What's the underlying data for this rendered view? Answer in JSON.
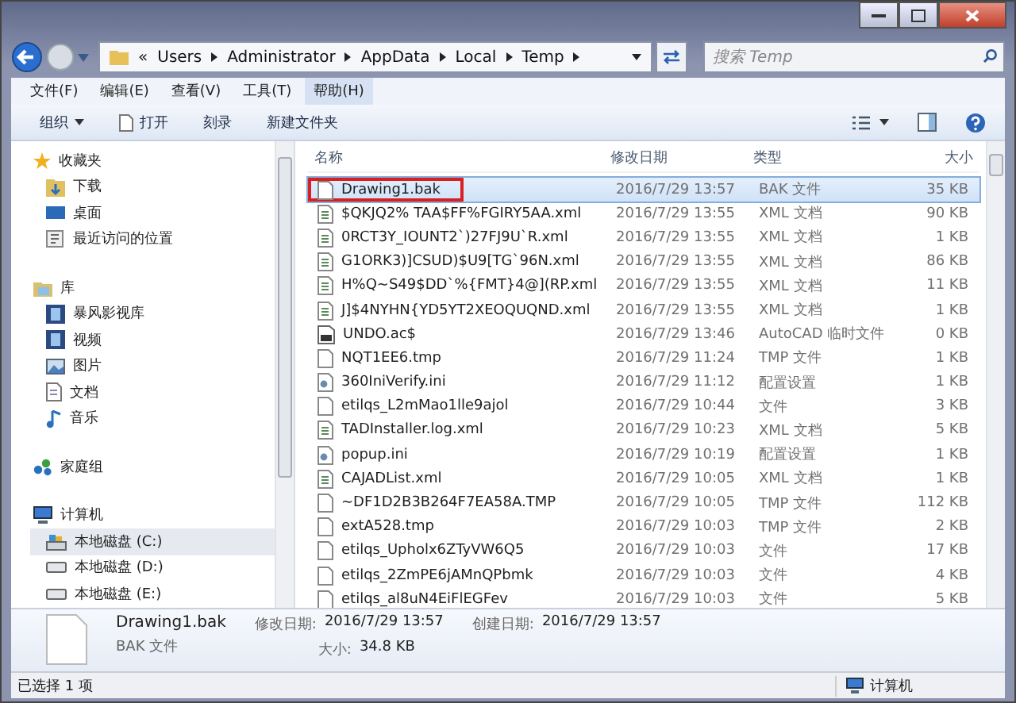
{
  "address": {
    "prefix": "«",
    "crumbs": [
      "Users",
      "Administrator",
      "AppData",
      "Local",
      "Temp"
    ]
  },
  "search": {
    "placeholder": "搜索 Temp"
  },
  "menu": [
    {
      "label": "文件(F)",
      "selected": false
    },
    {
      "label": "编辑(E)",
      "selected": false
    },
    {
      "label": "查看(V)",
      "selected": false
    },
    {
      "label": "工具(T)",
      "selected": false
    },
    {
      "label": "帮助(H)",
      "selected": true
    }
  ],
  "toolbar": [
    {
      "label": "组织",
      "kind": "dropdown"
    },
    {
      "label": "打开",
      "kind": "open"
    },
    {
      "label": "刻录",
      "kind": "plain"
    },
    {
      "label": "新建文件夹",
      "kind": "plain"
    }
  ],
  "sidebar": [
    {
      "label": "收藏夹",
      "kind": "star",
      "selected": false,
      "children": [
        {
          "label": "下载",
          "kind": "download",
          "selected": false
        },
        {
          "label": "桌面",
          "kind": "desktop",
          "selected": false
        },
        {
          "label": "最近访问的位置",
          "kind": "recent",
          "selected": false
        }
      ]
    },
    {
      "label": "库",
      "kind": "library",
      "selected": false,
      "children": [
        {
          "label": "暴风影视库",
          "kind": "video",
          "selected": false
        },
        {
          "label": "视频",
          "kind": "video",
          "selected": false
        },
        {
          "label": "图片",
          "kind": "picture",
          "selected": false
        },
        {
          "label": "文档",
          "kind": "document",
          "selected": false
        },
        {
          "label": "音乐",
          "kind": "music",
          "selected": false
        }
      ]
    },
    {
      "label": "家庭组",
      "kind": "homegroup",
      "selected": false
    },
    {
      "label": "计算机",
      "kind": "computer",
      "selected": false,
      "children": [
        {
          "label": "本地磁盘 (C:)",
          "kind": "system",
          "selected": true
        },
        {
          "label": "本地磁盘 (D:)",
          "kind": "drive",
          "selected": false
        },
        {
          "label": "本地磁盘 (E:)",
          "kind": "drive",
          "selected": false
        }
      ]
    }
  ],
  "table": {
    "columns": [
      "名称",
      "修改日期",
      "类型",
      "大小"
    ],
    "rows": [
      {
        "name": "Drawing1.bak",
        "date": "2016/7/29 13:57",
        "type": "BAK 文件",
        "size": "35 KB",
        "kind": "file",
        "selected": true,
        "highlighted": true
      },
      {
        "name": "$QKJQ2% TAA$FF%FGIRY5AA.xml",
        "date": "2016/7/29 13:55",
        "type": "XML 文档",
        "size": "90 KB",
        "kind": "xml",
        "selected": false,
        "highlighted": false
      },
      {
        "name": "0RCT3Y_IOUNT2`)27FJ9U`R.xml",
        "date": "2016/7/29 13:55",
        "type": "XML 文档",
        "size": "1 KB",
        "kind": "xml",
        "selected": false,
        "highlighted": false
      },
      {
        "name": "G1ORK3)]CSUD)$U9[TG`96N.xml",
        "date": "2016/7/29 13:55",
        "type": "XML 文档",
        "size": "86 KB",
        "kind": "xml",
        "selected": false,
        "highlighted": false
      },
      {
        "name": "H%Q~S49$DD`%{FMT}4@](RP.xml",
        "date": "2016/7/29 13:55",
        "type": "XML 文档",
        "size": "11 KB",
        "kind": "xml",
        "selected": false,
        "highlighted": false
      },
      {
        "name": "J]$4NYHN{YD5YT2XEOQUQND.xml",
        "date": "2016/7/29 13:55",
        "type": "XML 文档",
        "size": "1 KB",
        "kind": "xml",
        "selected": false,
        "highlighted": false
      },
      {
        "name": "UNDO.ac$",
        "date": "2016/7/29 13:46",
        "type": "AutoCAD 临时文件",
        "size": "0 KB",
        "kind": "cad",
        "selected": false,
        "highlighted": false
      },
      {
        "name": "NQT1EE6.tmp",
        "date": "2016/7/29 11:24",
        "type": "TMP 文件",
        "size": "1 KB",
        "kind": "file",
        "selected": false,
        "highlighted": false
      },
      {
        "name": "360IniVerify.ini",
        "date": "2016/7/29 11:12",
        "type": "配置设置",
        "size": "1 KB",
        "kind": "ini",
        "selected": false,
        "highlighted": false
      },
      {
        "name": "etilqs_L2mMao1lle9ajol",
        "date": "2016/7/29 10:44",
        "type": "文件",
        "size": "3 KB",
        "kind": "file",
        "selected": false,
        "highlighted": false
      },
      {
        "name": "TADInstaller.log.xml",
        "date": "2016/7/29 10:23",
        "type": "XML 文档",
        "size": "5 KB",
        "kind": "xml",
        "selected": false,
        "highlighted": false
      },
      {
        "name": "popup.ini",
        "date": "2016/7/29 10:19",
        "type": "配置设置",
        "size": "1 KB",
        "kind": "ini",
        "selected": false,
        "highlighted": false
      },
      {
        "name": "CAJADList.xml",
        "date": "2016/7/29 10:05",
        "type": "XML 文档",
        "size": "1 KB",
        "kind": "xml",
        "selected": false,
        "highlighted": false
      },
      {
        "name": "~DF1D2B3B264F7EA58A.TMP",
        "date": "2016/7/29 10:05",
        "type": "TMP 文件",
        "size": "112 KB",
        "kind": "file",
        "selected": false,
        "highlighted": false
      },
      {
        "name": "extA528.tmp",
        "date": "2016/7/29 10:03",
        "type": "TMP 文件",
        "size": "2 KB",
        "kind": "file",
        "selected": false,
        "highlighted": false
      },
      {
        "name": "etilqs_Upholx6ZTyVW6Q5",
        "date": "2016/7/29 10:03",
        "type": "文件",
        "size": "17 KB",
        "kind": "file",
        "selected": false,
        "highlighted": false
      },
      {
        "name": "etilqs_2ZmPE6jAMnQPbmk",
        "date": "2016/7/29 10:03",
        "type": "文件",
        "size": "4 KB",
        "kind": "file",
        "selected": false,
        "highlighted": false
      },
      {
        "name": "etilqs_al8uN4EiFlEGFev",
        "date": "2016/7/29 10:03",
        "type": "文件",
        "size": "5 KB",
        "kind": "file",
        "selected": false,
        "highlighted": false
      }
    ]
  },
  "details": {
    "name": "Drawing1.bak",
    "type": "BAK 文件",
    "modified_label": "修改日期:",
    "modified": "2016/7/29 13:57",
    "created_label": "创建日期:",
    "created": "2016/7/29 13:57",
    "size_label": "大小:",
    "size": "34.8 KB"
  },
  "status_bar": {
    "selection": "已选择 1 项",
    "location": "计算机"
  }
}
